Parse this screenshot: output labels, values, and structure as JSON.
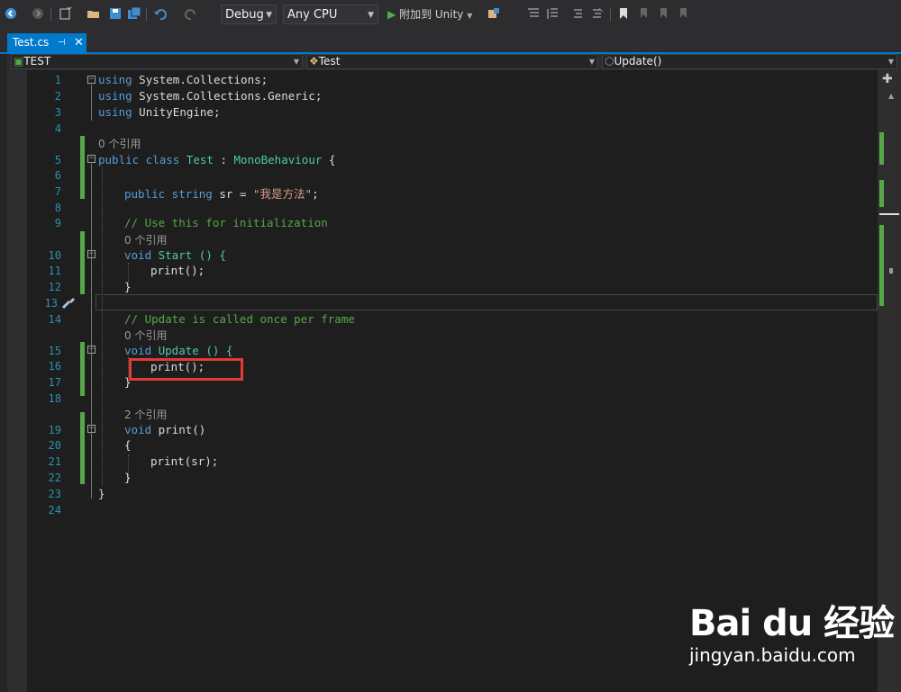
{
  "toolbar": {
    "config": "Debug",
    "platform": "Any CPU",
    "attach_label": "附加到 Unity"
  },
  "tab": {
    "title": "Test.cs",
    "pin": "⊣",
    "close": "✕"
  },
  "navbar": {
    "project": "TEST",
    "class": "Test",
    "member": "Update()"
  },
  "editor": {
    "line_numbers": [
      "1",
      "2",
      "3",
      "4",
      "5",
      "6",
      "7",
      "8",
      "9",
      "10",
      "11",
      "12",
      "13",
      "14",
      "15",
      "16",
      "17",
      "18",
      "19",
      "20",
      "21",
      "22",
      "23",
      "24"
    ],
    "lens_refs": {
      "class": "0 个引用",
      "start": "0 个引用",
      "update": "0 个引用",
      "print": "2 个引用"
    },
    "code": {
      "l1_kw": "using",
      "l1_rest": " System.Collections;",
      "l2_kw": "using",
      "l2_rest": " System.Collections.Generic;",
      "l3_kw": "using",
      "l3_rest": " UnityEngine;",
      "l5_kw": "public class",
      "l5_name": " Test ",
      "l5_colon": ": ",
      "l5_base": "MonoBehaviour",
      "l5_brace": " {",
      "l7_kw": "public string",
      "l7_rest": " sr = ",
      "l7_str": "\"我是方法\"",
      "l7_end": ";",
      "l9_comment": "// Use this for initialization",
      "l10_kw": "void",
      "l10_rest": " Start () {",
      "l11": "print();",
      "l12": "}",
      "l14_comment": "// Update is called once per frame",
      "l15_kw": "void",
      "l15_rest": " Update () {",
      "l16": "print();",
      "l17": "}",
      "l19_kw": "void",
      "l19_rest": " print()",
      "l20": "{",
      "l21": "print(sr);",
      "l22": "}",
      "l23": "}"
    }
  },
  "watermark": {
    "logo": "Bai du 经验",
    "url": "jingyan.baidu.com"
  },
  "colors": {
    "accent": "#007acc",
    "keyword": "#569cd6",
    "type": "#4ec9b0",
    "string": "#d69d85",
    "comment": "#57a64a",
    "highlight": "#e53935"
  }
}
